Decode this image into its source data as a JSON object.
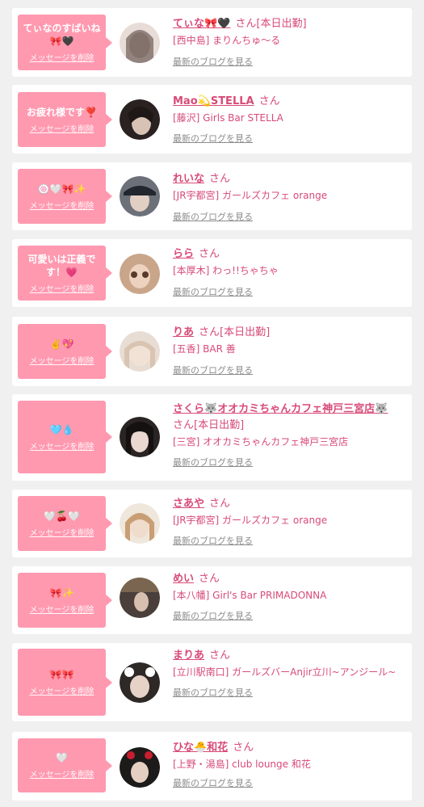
{
  "common": {
    "delete_label": "メッセージを削除",
    "blog_label": "最新のブログを見る",
    "san_label": "さん"
  },
  "items": [
    {
      "message": "てぃなのすばいね🎀🖤",
      "name": "てぃな🎀🖤",
      "suffix": "[本日出勤]",
      "shop": "[西中島] まりんちゅ～る",
      "avatar_color": "#c8b6ac"
    },
    {
      "message": "お疲れ様です❣️",
      "name": "Mao💫STELLA",
      "suffix": "",
      "shop": "[藤沢] Girls Bar STELLA",
      "avatar_color": "#3a302c"
    },
    {
      "message": "🍥🤍🎀✨",
      "name": "れいな",
      "suffix": "",
      "shop": "[JR宇都宮] ガールズカフェ orange",
      "avatar_color": "#5a5f6a"
    },
    {
      "message": "可愛いは正義です！💗",
      "name": "らら",
      "suffix": "",
      "shop": "[本厚木] わっ!!ちゃちゃ",
      "avatar_color": "#d9b79a"
    },
    {
      "message": "✌️💖",
      "name": "りあ",
      "suffix": "[本日出勤]",
      "shop": "[五香] BAR 善",
      "avatar_color": "#e6d6c8"
    },
    {
      "message": "🩵💧",
      "name": "さくら🐺オオカミちゃんカフェ神戸三宮店🐺",
      "suffix": "[本日出勤]",
      "shop": "[三宮] オオカミちゃんカフェ神戸三宮店",
      "avatar_color": "#2b2424"
    },
    {
      "message": "🤍🍒🤍",
      "name": "さあや",
      "suffix": "",
      "shop": "[JR宇都宮] ガールズカフェ orange",
      "avatar_color": "#d8b694"
    },
    {
      "message": "🎀✨",
      "name": "めい",
      "suffix": "",
      "shop": "[本八幡] Girl's Bar PRIMADONNA",
      "avatar_color": "#4a3f3a"
    },
    {
      "message": "🎀🎀",
      "name": "まりあ",
      "suffix": "",
      "shop": "[立川駅南口] ガールズバーAnjir立川~アンジール~",
      "avatar_color": "#2e2826"
    },
    {
      "message": "🤍",
      "name": "ひな🐣和花",
      "suffix": "",
      "shop": "[上野・湯島] club lounge 和花",
      "avatar_color": "#1d1a1a"
    }
  ]
}
